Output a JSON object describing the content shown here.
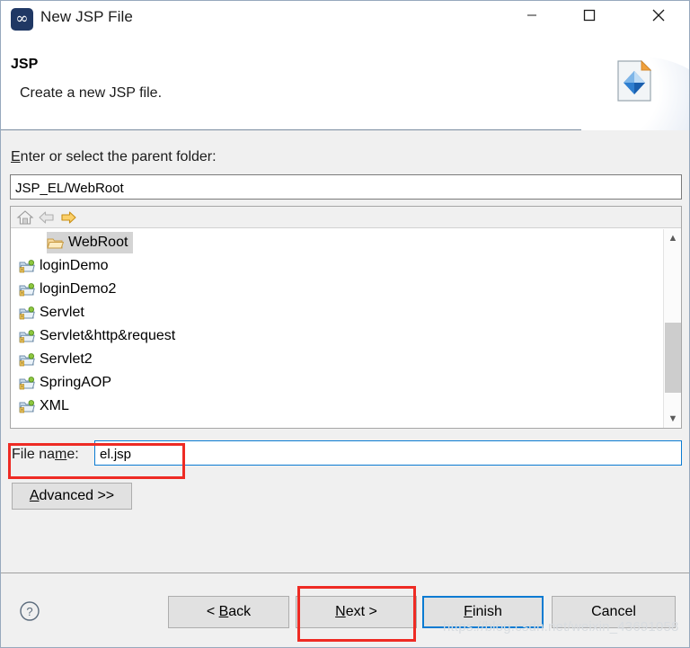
{
  "window": {
    "title": "New JSP File",
    "app_icon": "myeclipse-icon",
    "controls": {
      "minimize": "minimize-icon",
      "maximize": "maximize-icon",
      "close": "close-icon"
    }
  },
  "header": {
    "title": "JSP",
    "description": "Create a new JSP file.",
    "banner_icon": "jsp-file-icon"
  },
  "parent_folder": {
    "label_prefix": "",
    "label_mnemonic": "E",
    "label_rest": "nter or select the parent folder:",
    "value": "JSP_EL/WebRoot",
    "placeholder": ""
  },
  "tree_toolbar": {
    "home": "home-icon",
    "back": "back-arrow-icon",
    "forward": "forward-arrow-icon"
  },
  "tree": {
    "items": [
      {
        "label": "WebRoot",
        "icon": "open-folder-icon",
        "selected": true,
        "indent": true
      },
      {
        "label": "loginDemo",
        "icon": "web-project-folder-icon",
        "selected": false,
        "indent": false
      },
      {
        "label": "loginDemo2",
        "icon": "web-project-folder-icon",
        "selected": false,
        "indent": false
      },
      {
        "label": "Servlet",
        "icon": "web-project-folder-icon",
        "selected": false,
        "indent": false
      },
      {
        "label": "Servlet&http&request",
        "icon": "web-project-folder-icon",
        "selected": false,
        "indent": false
      },
      {
        "label": "Servlet2",
        "icon": "web-project-folder-icon",
        "selected": false,
        "indent": false
      },
      {
        "label": "SpringAOP",
        "icon": "web-project-folder-icon",
        "selected": false,
        "indent": false
      },
      {
        "label": "XML",
        "icon": "web-project-folder-icon",
        "selected": false,
        "indent": false
      }
    ]
  },
  "file_name": {
    "label_prefix": "File na",
    "label_mnemonic": "m",
    "label_rest": "e:",
    "value": "el.jsp",
    "placeholder": ""
  },
  "advanced": {
    "mnemonic": "A",
    "rest": "dvanced >>"
  },
  "footer": {
    "help": "help-icon",
    "buttons": {
      "back": {
        "prefix": "< ",
        "mnemonic": "B",
        "rest": "ack"
      },
      "next": {
        "prefix": "",
        "mnemonic": "N",
        "rest": "ext >"
      },
      "finish": {
        "prefix": "",
        "mnemonic": "F",
        "rest": "inish"
      },
      "cancel": {
        "prefix": "",
        "mnemonic": "",
        "rest": "Cancel"
      }
    }
  },
  "watermark": "https://blog.csdn.net/weixin_43691058",
  "colors": {
    "accent": "#0a7bd2",
    "annotation": "#ee2b24",
    "title_icon_bg": "#203864",
    "body_bg": "#f0f0f0",
    "selection": "#d4d4d4"
  }
}
